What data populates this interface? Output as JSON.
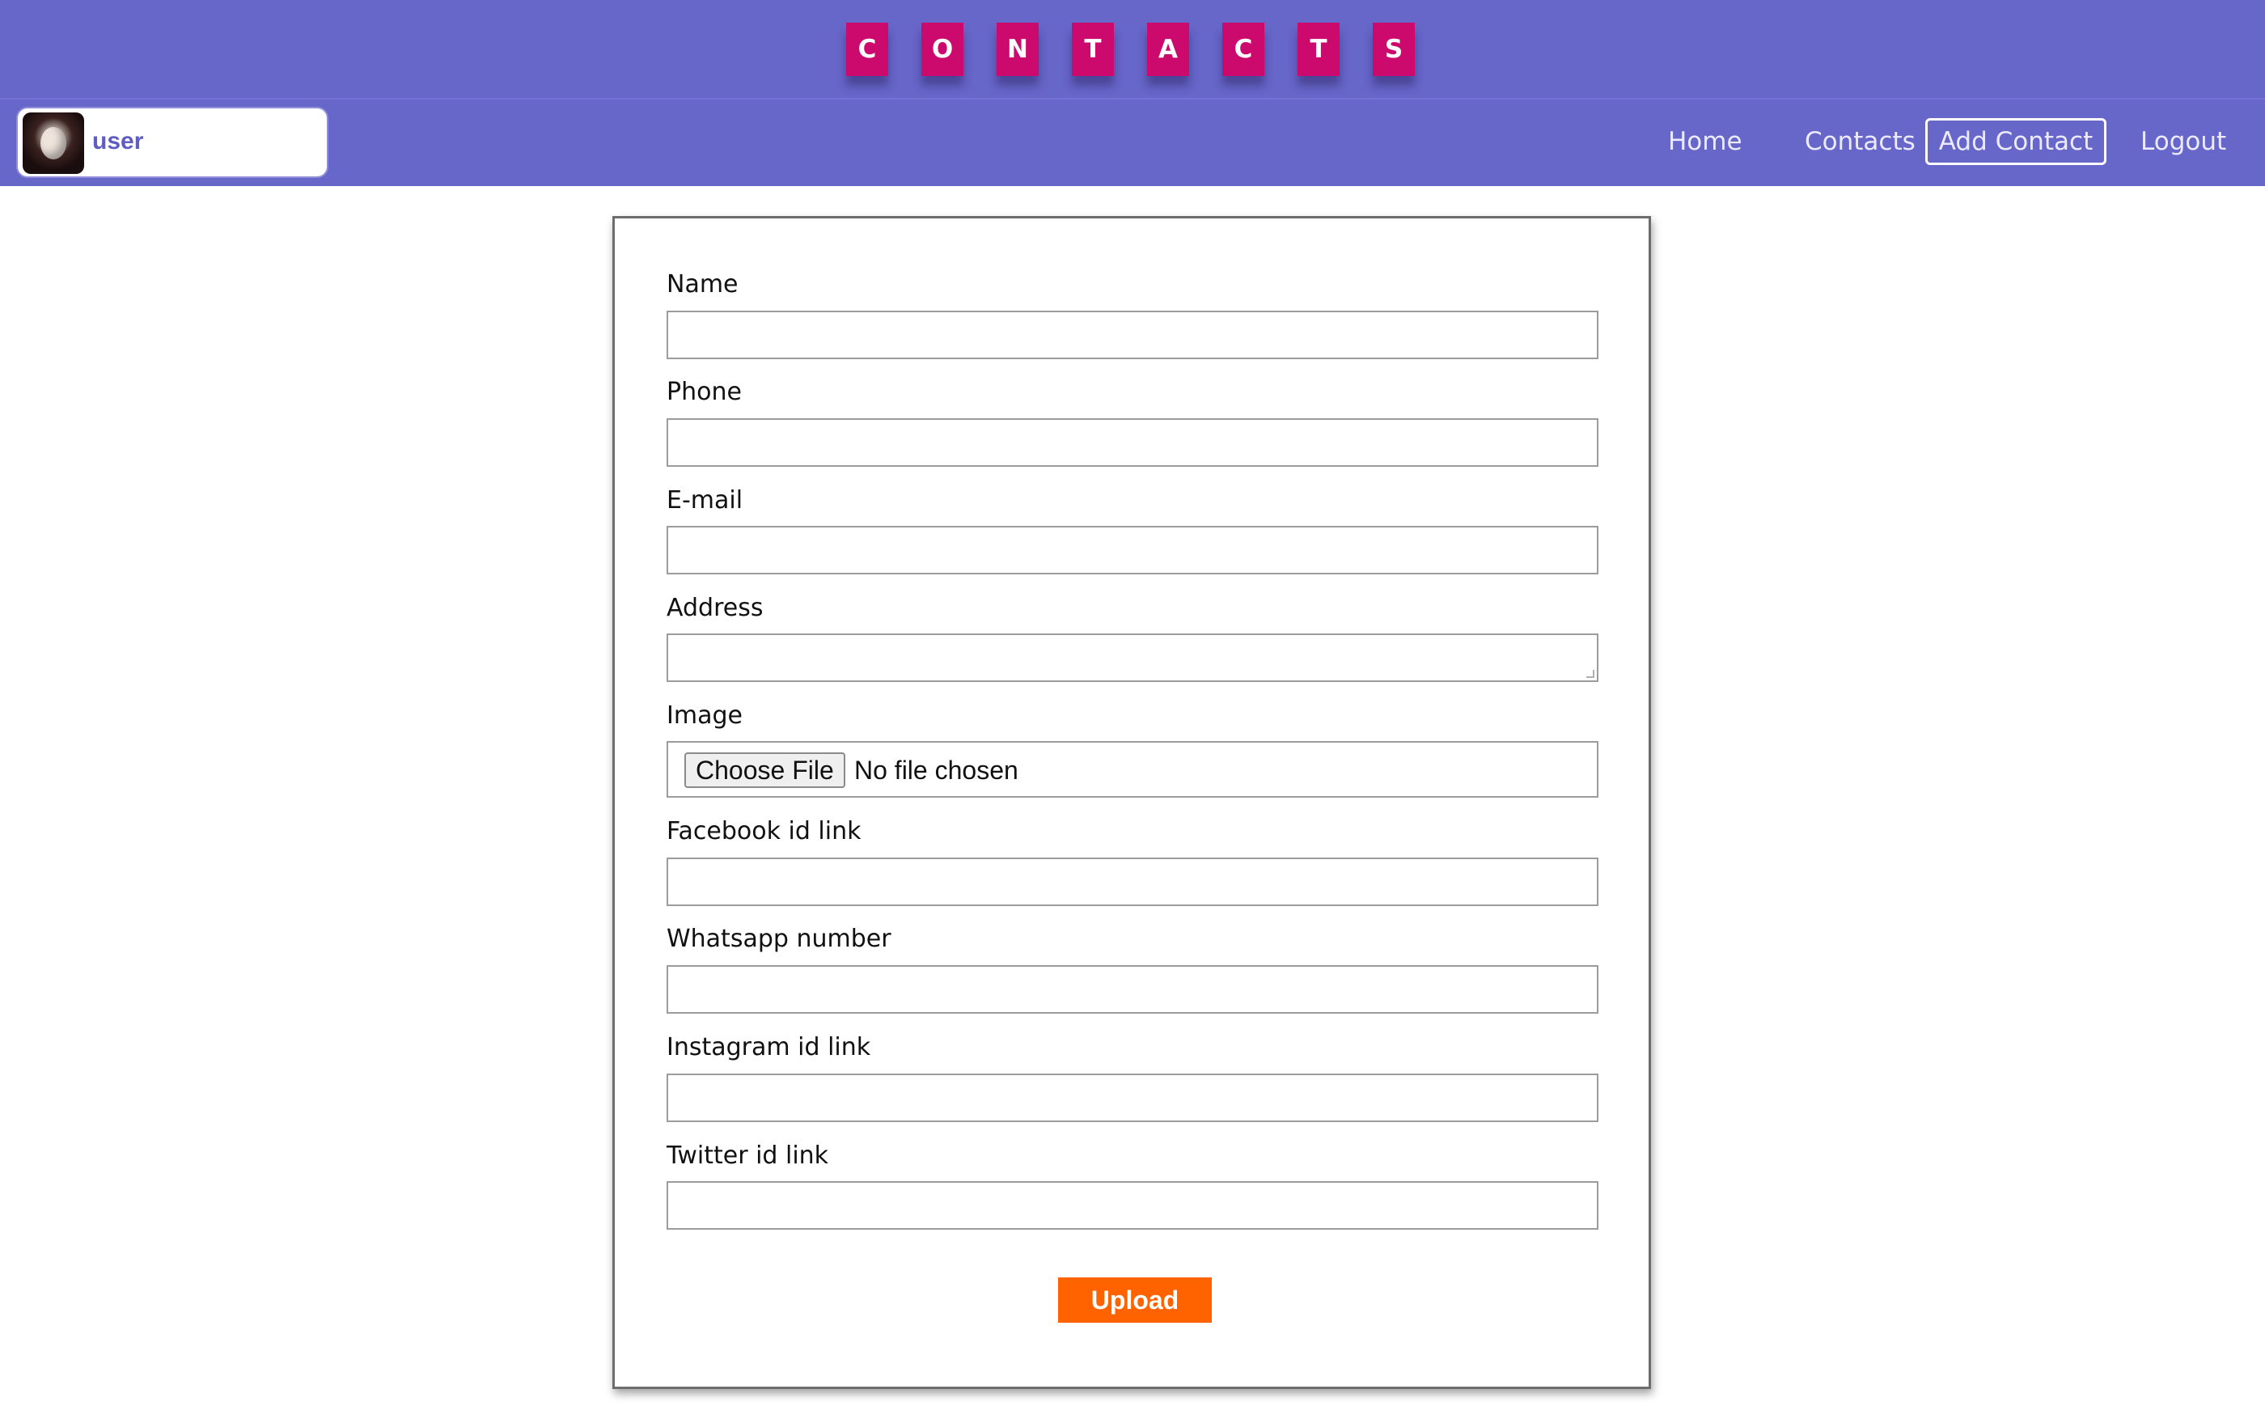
{
  "header": {
    "title_letters": [
      "C",
      "O",
      "N",
      "T",
      "A",
      "C",
      "T",
      "S"
    ],
    "user": {
      "name": "user"
    },
    "nav": {
      "home": "Home",
      "contacts": "Contacts",
      "add_contact": "Add Contact",
      "logout": "Logout"
    }
  },
  "form": {
    "name_label": "Name",
    "phone_label": "Phone",
    "email_label": "E-mail",
    "address_label": "Address",
    "image_label": "Image",
    "image_button": "Choose File",
    "image_status": "No file chosen",
    "facebook_label": "Facebook id link",
    "whatsapp_label": "Whatsapp number",
    "instagram_label": "Instagram id link",
    "twitter_label": "Twitter id link",
    "submit_label": "Upload"
  },
  "colors": {
    "header_bg": "#6766c9",
    "title_tile": "#cc0a6e",
    "upload_button": "#ff6300",
    "user_name": "#5f5cc2"
  }
}
